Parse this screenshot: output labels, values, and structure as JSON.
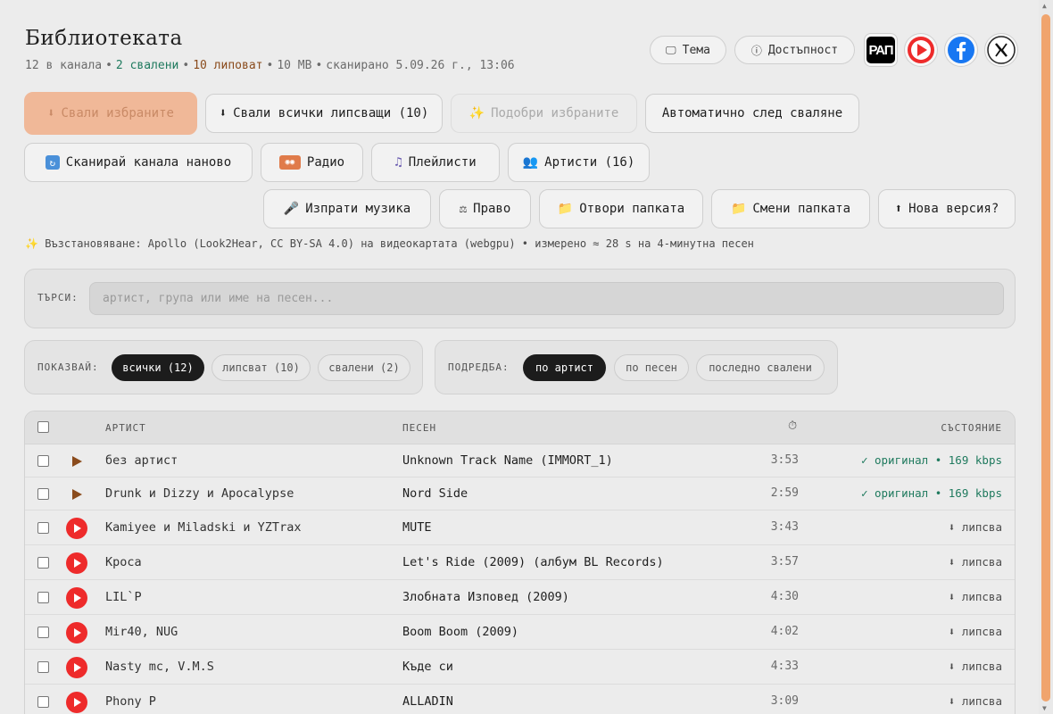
{
  "header": {
    "title": "Библиотеката",
    "stats": {
      "channels": "12 в канала",
      "downloaded": "2 свалени",
      "missing": "10 липоват",
      "size": "10 MB",
      "scanned": "сканирано 5.09.26 г., 13:06"
    },
    "theme_label": "Тема",
    "accessibility_label": "Достъпност",
    "rap_logo": "РАП"
  },
  "actions": {
    "download_selected": "Свали избраните",
    "download_all_missing": "Свали всички липсващи (10)",
    "enhance_selected": "Подобри избраните",
    "auto_after_download": "Автоматично след сваляне",
    "rescan_channel": "Сканирай канала наново",
    "radio": "Радио",
    "playlists": "Плейлисти",
    "artists": "Артисти (16)",
    "send_music": "Изпрати музика",
    "law": "Право",
    "open_folder": "Отвори папката",
    "change_folder": "Смени папката",
    "new_version": "Нова версия?"
  },
  "note": "Възстановяване: Apollo (Look2Hear, CC BY-SA 4.0) на видеокартата (webgpu) • измерено ≈ 28 s на 4-минутна песен",
  "search": {
    "label": "ТЪРСИ:",
    "placeholder": "артист, група или име на песен..."
  },
  "filters": {
    "show_label": "ПОКАЗВАЙ:",
    "show_options": [
      "всички (12)",
      "липсват (10)",
      "свалени (2)"
    ],
    "sort_label": "ПОДРЕДБА:",
    "sort_options": [
      "по артист",
      "по песен",
      "последно свалени"
    ]
  },
  "table": {
    "headers": {
      "artist": "АРТИСТ",
      "song": "ПЕСЕН",
      "duration_icon": "⏱",
      "status": "СЪСТОЯНИЕ"
    },
    "rows": [
      {
        "artist": "без артист",
        "song": "Unknown Track Name (IMMORT_1)",
        "duration": "3:53",
        "status": "✓ оригинал • 169 kbps"
      },
      {
        "artist": "Drunk и Dizzy и Apocalypse",
        "song": "Nord Side",
        "duration": "2:59",
        "status": "✓ оригинал • 169 kbps"
      },
      {
        "artist": "Kamiyee и Miladski и YZTrax",
        "song": "MUTE",
        "duration": "3:43",
        "status": "⬇ липсва"
      },
      {
        "artist": "Кроса",
        "song": "Let's Ride (2009) (албум BL Records)",
        "duration": "3:57",
        "status": "⬇ липсва"
      },
      {
        "artist": "LIL`P",
        "song": "Злобната Изповед (2009)",
        "duration": "4:30",
        "status": "⬇ липсва"
      },
      {
        "artist": "Mir40, NUG",
        "song": "Boom Boom (2009)",
        "duration": "4:02",
        "status": "⬇ липсва"
      },
      {
        "artist": "Nasty mc, V.M.S",
        "song": "Къде си",
        "duration": "4:33",
        "status": "⬇ липсва"
      },
      {
        "artist": "Phony P",
        "song": "ALLADIN",
        "duration": "3:09",
        "status": "⬇ липсва"
      }
    ]
  },
  "colors": {
    "accent": "#f0a46d",
    "green": "#1f7a5e",
    "brown": "#8a4b1c",
    "youtube": "#ee2b2b",
    "facebook": "#1877f2"
  }
}
